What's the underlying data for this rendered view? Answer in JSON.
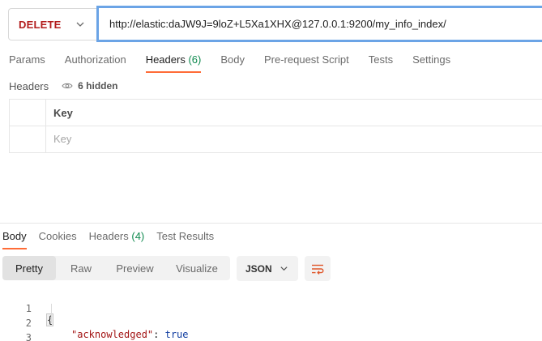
{
  "request": {
    "method": "DELETE",
    "url": "http://elastic:daJW9J=9loZ+L5Xa1XHX@127.0.0.1:9200/my_info_index/"
  },
  "request_tabs": [
    {
      "label": "Params",
      "count": ""
    },
    {
      "label": "Authorization",
      "count": ""
    },
    {
      "label": "Headers",
      "count": "(6)"
    },
    {
      "label": "Body",
      "count": ""
    },
    {
      "label": "Pre-request Script",
      "count": ""
    },
    {
      "label": "Tests",
      "count": ""
    },
    {
      "label": "Settings",
      "count": ""
    }
  ],
  "headers_section": {
    "label": "Headers",
    "hidden_label": "6 hidden",
    "table": {
      "column_key": "Key",
      "key_placeholder": "Key"
    }
  },
  "response_tabs": [
    {
      "label": "Body",
      "count": ""
    },
    {
      "label": "Cookies",
      "count": ""
    },
    {
      "label": "Headers",
      "count": "(4)"
    },
    {
      "label": "Test Results",
      "count": ""
    }
  ],
  "response_toolbar": {
    "views": [
      "Pretty",
      "Raw",
      "Preview",
      "Visualize"
    ],
    "format": "JSON"
  },
  "response_body": {
    "lines": [
      {
        "number": "1",
        "open": "{"
      },
      {
        "number": "2",
        "key": "\"acknowledged\"",
        "sep": ": ",
        "value": "true"
      },
      {
        "number": "3",
        "close": "}"
      }
    ]
  },
  "colors": {
    "accent": "#ff6c37",
    "method_delete": "#b31d1d",
    "count_green": "#0f8a4f",
    "url_focus_border": "#6ba4e6"
  },
  "icons": [
    "chevron-down-icon",
    "eye-icon",
    "wrap-lines-icon"
  ]
}
